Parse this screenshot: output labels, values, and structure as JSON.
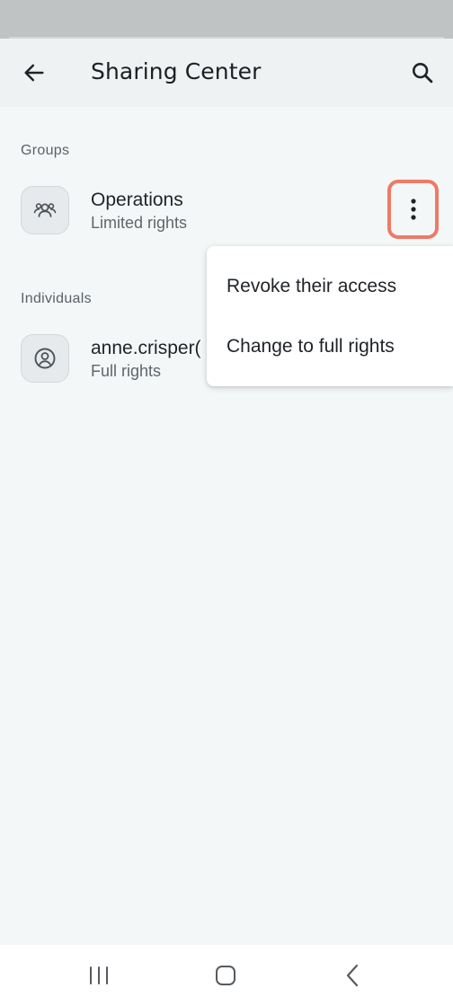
{
  "header": {
    "title": "Sharing Center"
  },
  "sections": {
    "groups_label": "Groups",
    "individuals_label": "Individuals"
  },
  "groups": [
    {
      "name": "Operations",
      "rights": "Limited rights",
      "icon": "group-icon"
    }
  ],
  "individuals": [
    {
      "name": "anne.crisper(",
      "rights": "Full rights",
      "icon": "person-circle-icon"
    }
  ],
  "menu": {
    "items": [
      {
        "label": "Revoke their access"
      },
      {
        "label": "Change to full rights"
      }
    ]
  },
  "colors": {
    "highlight": "#ef7a67",
    "background": "#f4f7f8",
    "app_bar": "#eef2f3"
  },
  "icons": {
    "back": "arrow-left-icon",
    "search": "search-icon",
    "more": "more-vert-icon",
    "nav_recents": "recents-icon",
    "nav_home": "home-icon",
    "nav_back": "chevron-left-icon"
  }
}
